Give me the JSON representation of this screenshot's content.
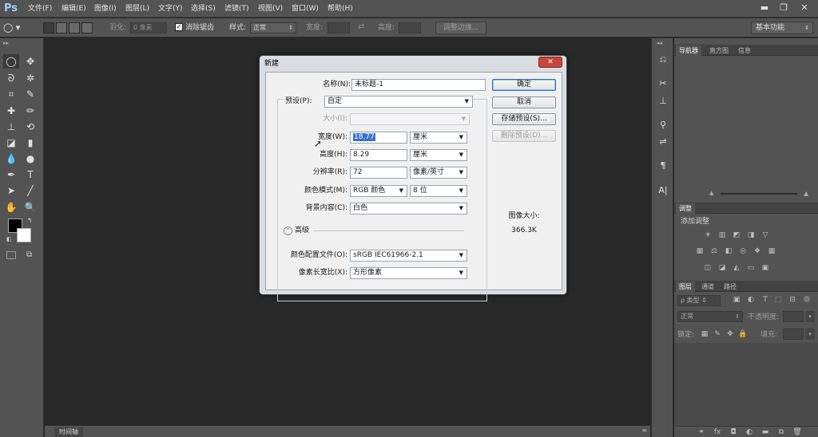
{
  "app": {
    "logo": "Ps"
  },
  "menu": [
    "文件(F)",
    "编辑(E)",
    "图像(I)",
    "图层(L)",
    "文字(Y)",
    "选择(S)",
    "滤镜(T)",
    "视图(V)",
    "窗口(W)",
    "帮助(H)"
  ],
  "window_controls": {
    "minimize": "▬",
    "restore": "❐",
    "close": "✕"
  },
  "options_bar": {
    "feather_label": "羽化:",
    "feather_value": "0 像素",
    "antialias_label": "消除锯齿",
    "style_label": "样式:",
    "style_value": "正常",
    "width_label": "宽度:",
    "height_label": "高度:",
    "refine_edge": "调整边缘...",
    "workspace": "基本功能"
  },
  "timeline_tab": "时间轴",
  "panels": {
    "top_tabs": [
      "导航器",
      "直方图",
      "信息"
    ],
    "adjust_tabs": [
      "调整",
      "样式"
    ],
    "adjust_title": "添加调整",
    "layers_tabs": [
      "图层",
      "通道",
      "路径"
    ],
    "kind_label": "类型",
    "blend_mode": "正常",
    "opacity_label": "不透明度:",
    "lock_label": "锁定:",
    "fill_label": "填充:"
  },
  "dialog": {
    "title": "新建",
    "close": "✕",
    "name_label": "名称(N):",
    "name_value": "未标题-1",
    "preset_label": "预设(P):",
    "preset_value": "自定",
    "size_label": "大小(I):",
    "width_label": "宽度(W):",
    "width_value": "18.77",
    "width_unit": "厘米",
    "height_label": "高度(H):",
    "height_value": "8.29",
    "height_unit": "厘米",
    "resolution_label": "分辨率(R):",
    "resolution_value": "72",
    "resolution_unit": "像素/英寸",
    "color_mode_label": "颜色模式(M):",
    "color_mode_value": "RGB 颜色",
    "bit_depth": "8 位",
    "background_label": "背景内容(C):",
    "background_value": "白色",
    "advanced_label": "高级",
    "profile_label": "颜色配置文件(O):",
    "profile_value": "sRGB IEC61966-2.1",
    "aspect_label": "像素长宽比(X):",
    "aspect_value": "方形像素",
    "ok": "确定",
    "cancel": "取消",
    "save_preset": "存储预设(S)...",
    "delete_preset": "删除预设(D)...",
    "image_size_label": "图像大小:",
    "image_size_value": "366.3K"
  },
  "colors": {
    "bg": "#282828",
    "chrome": "#535353",
    "dialog": "#f0f0f0",
    "close_red": "#c7473a",
    "selection": "#3a6fd0"
  }
}
